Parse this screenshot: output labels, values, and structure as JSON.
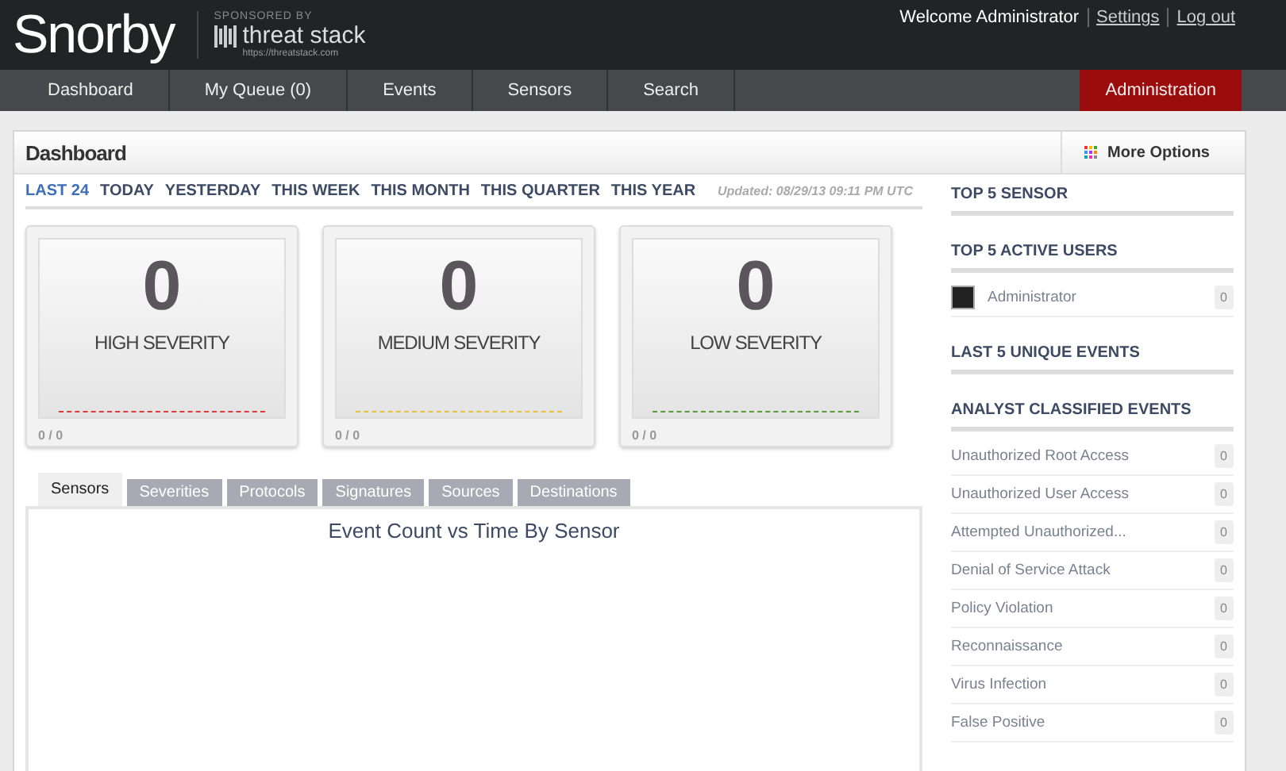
{
  "header": {
    "logo": "Snorby",
    "sponsor_label": "SPONSORED BY",
    "sponsor_name": "threat stack",
    "sponsor_url": "https://threatstack.com",
    "welcome": "Welcome Administrator",
    "links": [
      "Settings",
      "Log out"
    ]
  },
  "nav": [
    {
      "label": "Dashboard",
      "kind": "tab"
    },
    {
      "label": "My Queue (0)",
      "kind": "tab"
    },
    {
      "label": "Events",
      "kind": "tab"
    },
    {
      "label": "Sensors",
      "kind": "tab"
    },
    {
      "label": "Search",
      "kind": "tab"
    },
    {
      "label": "Administration",
      "kind": "admin"
    }
  ],
  "panel": {
    "title": "Dashboard",
    "more_options": "More Options"
  },
  "ranges": [
    {
      "label": "LAST 24",
      "selected": true
    },
    {
      "label": "TODAY",
      "selected": false
    },
    {
      "label": "YESTERDAY",
      "selected": false
    },
    {
      "label": "THIS WEEK",
      "selected": false
    },
    {
      "label": "THIS MONTH",
      "selected": false
    },
    {
      "label": "THIS QUARTER",
      "selected": false
    },
    {
      "label": "THIS YEAR",
      "selected": false
    }
  ],
  "updated": "Updated: 08/29/13 09:11 PM UTC",
  "severities": [
    {
      "count": "0",
      "label": "HIGH SEVERITY",
      "color": "#e0393b",
      "ratio": "0 / 0"
    },
    {
      "count": "0",
      "label": "MEDIUM SEVERITY",
      "color": "#e8c33a",
      "ratio": "0 / 0"
    },
    {
      "count": "0",
      "label": "LOW SEVERITY",
      "color": "#5a9a3a",
      "ratio": "0 / 0"
    }
  ],
  "tabs": [
    {
      "label": "Sensors",
      "selected": true
    },
    {
      "label": "Severities",
      "selected": false
    },
    {
      "label": "Protocols",
      "selected": false
    },
    {
      "label": "Signatures",
      "selected": false
    },
    {
      "label": "Sources",
      "selected": false
    },
    {
      "label": "Destinations",
      "selected": false
    }
  ],
  "chart_title": "Event Count vs Time By Sensor",
  "sidebar": [
    {
      "title": "TOP 5 SENSOR"
    },
    {
      "title": "TOP 5 ACTIVE USERS",
      "items": [
        {
          "label": "Administrator",
          "count": "0",
          "avatar": true
        }
      ]
    },
    {
      "title": "LAST 5 UNIQUE EVENTS"
    },
    {
      "title": "ANALYST CLASSIFIED EVENTS",
      "items": [
        {
          "label": "Unauthorized Root Access",
          "count": "0"
        },
        {
          "label": "Unauthorized User Access",
          "count": "0"
        },
        {
          "label": "Attempted Unauthorized...",
          "count": "0"
        },
        {
          "label": "Denial of Service Attack",
          "count": "0"
        },
        {
          "label": "Policy Violation",
          "count": "0"
        },
        {
          "label": "Reconnaissance",
          "count": "0"
        },
        {
          "label": "Virus Infection",
          "count": "0"
        },
        {
          "label": "False Positive",
          "count": "0"
        }
      ]
    }
  ]
}
